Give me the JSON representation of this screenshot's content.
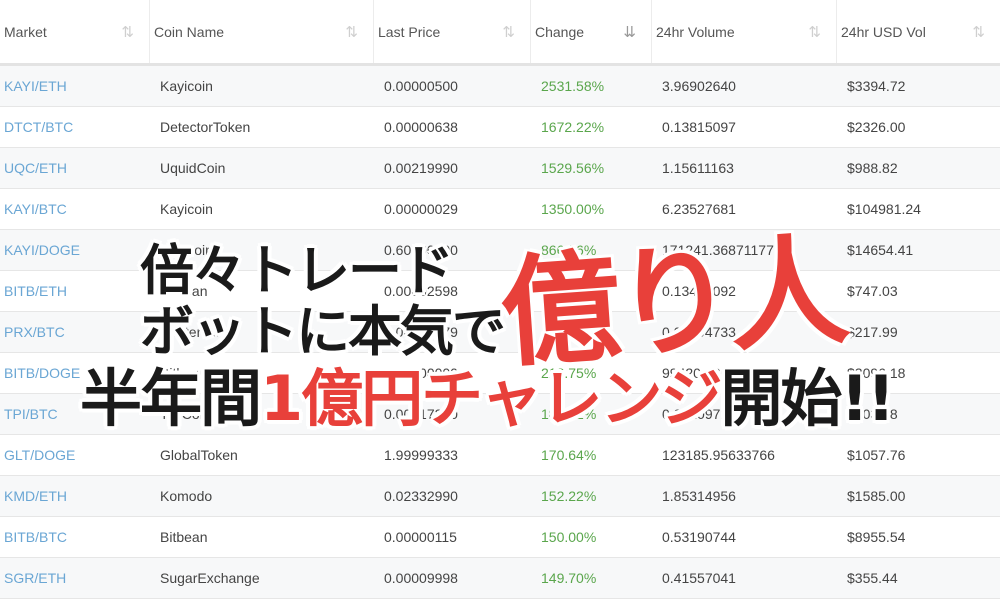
{
  "table": {
    "headers": [
      {
        "label": "Market",
        "sort": "⇅"
      },
      {
        "label": "Coin Name",
        "sort": "⇅"
      },
      {
        "label": "Last Price",
        "sort": "⇅"
      },
      {
        "label": "Change",
        "sort": "⇊"
      },
      {
        "label": "24hr Volume",
        "sort": "⇅"
      },
      {
        "label": "24hr USD Vol",
        "sort": "⇅"
      }
    ],
    "rows": [
      {
        "market": "KAYI/ETH",
        "coin": "Kayicoin",
        "price": "0.00000500",
        "change": "2531.58%",
        "volume": "3.96902640",
        "usd": "$3394.72"
      },
      {
        "market": "DTCT/BTC",
        "coin": "DetectorToken",
        "price": "0.00000638",
        "change": "1672.22%",
        "volume": "0.13815097",
        "usd": "$2326.00"
      },
      {
        "market": "UQC/ETH",
        "coin": "UquidCoin",
        "price": "0.00219990",
        "change": "1529.56%",
        "volume": "1.15611163",
        "usd": "$988.82"
      },
      {
        "market": "KAYI/BTC",
        "coin": "Kayicoin",
        "price": "0.00000029",
        "change": "1350.00%",
        "volume": "6.23527681",
        "usd": "$104981.24"
      },
      {
        "market": "KAYI/DOGE",
        "coin": "Kayicoin",
        "price": "0.60000000",
        "change": "866.76%",
        "volume": "171241.36871177",
        "usd": "$14654.41"
      },
      {
        "market": "BITB/ETH",
        "coin": "Bitbean",
        "price": "0.00002598",
        "change": "",
        "volume": "0.13405092",
        "usd": "$747.03"
      },
      {
        "market": "PRX/BTC",
        "coin": "Printerium",
        "price": "0.00000979",
        "change": "",
        "volume": "0.01294733",
        "usd": "$217.99"
      },
      {
        "market": "BITB/DOGE",
        "coin": "Bitbean",
        "price": "3.50000000",
        "change": "213.75%",
        "volume": "99420.28074",
        "usd": "$2096.18"
      },
      {
        "market": "TPI/BTC",
        "coin": "TPICoin",
        "price": "0.00017200",
        "change": "186.52%",
        "volume": "0.01209724",
        "usd": "$203.68"
      },
      {
        "market": "GLT/DOGE",
        "coin": "GlobalToken",
        "price": "1.99999333",
        "change": "170.64%",
        "volume": "123185.95633766",
        "usd": "$1057.76"
      },
      {
        "market": "KMD/ETH",
        "coin": "Komodo",
        "price": "0.02332990",
        "change": "152.22%",
        "volume": "1.85314956",
        "usd": "$1585.00"
      },
      {
        "market": "BITB/BTC",
        "coin": "Bitbean",
        "price": "0.00000115",
        "change": "150.00%",
        "volume": "0.53190744",
        "usd": "$8955.54"
      },
      {
        "market": "SGR/ETH",
        "coin": "SugarExchange",
        "price": "0.00009998",
        "change": "149.70%",
        "volume": "0.41557041",
        "usd": "$355.44"
      }
    ]
  },
  "banner": {
    "line1": "倍々トレード",
    "line2": "ボットに本気で",
    "line3_a": "半年間",
    "line3_b": "1億円チャレンジ",
    "line3_c": "開始!!",
    "brush": "億り人"
  },
  "colors": {
    "market_link": "#6aa6d4",
    "change_positive": "#5aa64c",
    "accent_red": "#e8403a"
  }
}
